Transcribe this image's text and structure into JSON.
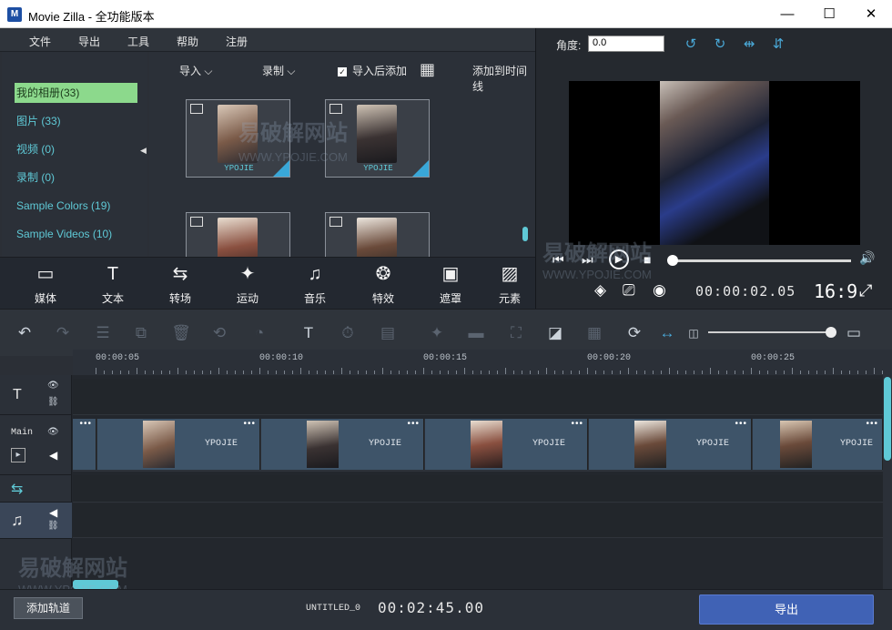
{
  "window": {
    "logo": "M",
    "title": "Movie Zilla - 全功能版本",
    "minimize": "—",
    "maximize": "☐",
    "close": "✕"
  },
  "menu": [
    "文件",
    "导出",
    "工具",
    "帮助",
    "注册"
  ],
  "sidebar": {
    "items": [
      {
        "label": "我的相册(33)"
      },
      {
        "label": "图片 (33)"
      },
      {
        "label": "视频 (0)"
      },
      {
        "label": "录制 (0)"
      },
      {
        "label": "Sample Colors (19)"
      },
      {
        "label": "Sample Videos (10)"
      }
    ],
    "collapse": "◀"
  },
  "library": {
    "import_label": "导入 ⌵",
    "record_label": "录制 ⌵",
    "add_after_import": "导入后添加",
    "checkbox": "✓",
    "grid_icon": "▦",
    "add_to_timeline": "添加到时间线",
    "thumbs": [
      {
        "caption": "YPOJIE",
        "selected": true
      },
      {
        "caption": "YPOJIE",
        "selected": true
      },
      {
        "caption": "",
        "selected": false
      },
      {
        "caption": "",
        "selected": false
      }
    ]
  },
  "toolbar": [
    {
      "icon": "▭",
      "label": "媒体"
    },
    {
      "icon": "T",
      "label": "文本"
    },
    {
      "icon": "⇆",
      "label": "转场"
    },
    {
      "icon": "✦",
      "label": "运动"
    },
    {
      "icon": "♫",
      "label": "音乐"
    },
    {
      "icon": "❂",
      "label": "特效"
    },
    {
      "icon": "▣",
      "label": "遮罩"
    },
    {
      "icon": "▨",
      "label": "元素"
    }
  ],
  "preview": {
    "angle_label": "角度:",
    "angle_value": "0.0",
    "icons": [
      "↺",
      "↻",
      "⇹",
      "⇵"
    ],
    "controls": [
      "⏮",
      "⏭",
      "▶",
      "■",
      "🔊"
    ],
    "bottom_icons": [
      "◈",
      "⎚",
      "◉"
    ],
    "time": "00:00:02.05",
    "ratio": "16:9",
    "fullscreen": "⤢",
    "progress": 0.02
  },
  "timeline_tools": [
    "↶",
    "↷",
    "☰",
    "⧉",
    "🗑",
    "⟲",
    "◔",
    "T",
    "⏱",
    "▤",
    "✦",
    "▬",
    "⛶",
    "◪",
    "▦",
    "⟳",
    "↔",
    "◫",
    "▭"
  ],
  "ruler": [
    "00:00:05",
    "00:00:10",
    "00:00:15",
    "00:00:20",
    "00:00:25"
  ],
  "tracks": {
    "text_icon": "T",
    "eye": "👁",
    "link": "⛓",
    "main_label": "Main",
    "play": "▸",
    "speaker": "◀",
    "transition_icon": "⇆",
    "music_icon": "♫",
    "clips": [
      {
        "label": "YPOJIE"
      },
      {
        "label": "YPOJIE"
      },
      {
        "label": "YPOJIE"
      },
      {
        "label": "YPOJIE"
      },
      {
        "label": "YPOJIE"
      }
    ],
    "dots": "•••"
  },
  "bottom": {
    "add_track": "添加轨道",
    "project": "UNTITLED_0",
    "total_time": "00:02:45.00",
    "export": "导出"
  },
  "watermark": {
    "big": "易破解网站",
    "small": "WWW.YPOJIE.COM"
  },
  "colors": {
    "accent": "#5fc9d6",
    "active_item": "#8cd98c",
    "export": "#4062b5"
  }
}
